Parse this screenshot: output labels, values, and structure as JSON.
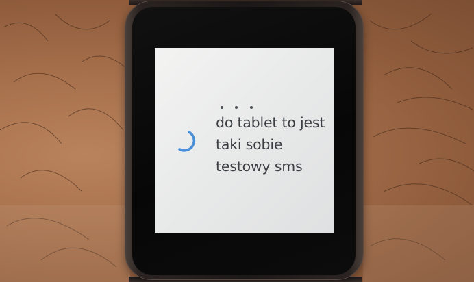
{
  "notification": {
    "lines": [
      "do tablet to jest",
      "taki sobie",
      "testowy sms"
    ]
  },
  "colors": {
    "screen_background": "#eceded",
    "text": "#3b3f43",
    "spinner_accent": "#4a8fd6"
  },
  "icons": {
    "progress": "loading-spinner-icon"
  }
}
